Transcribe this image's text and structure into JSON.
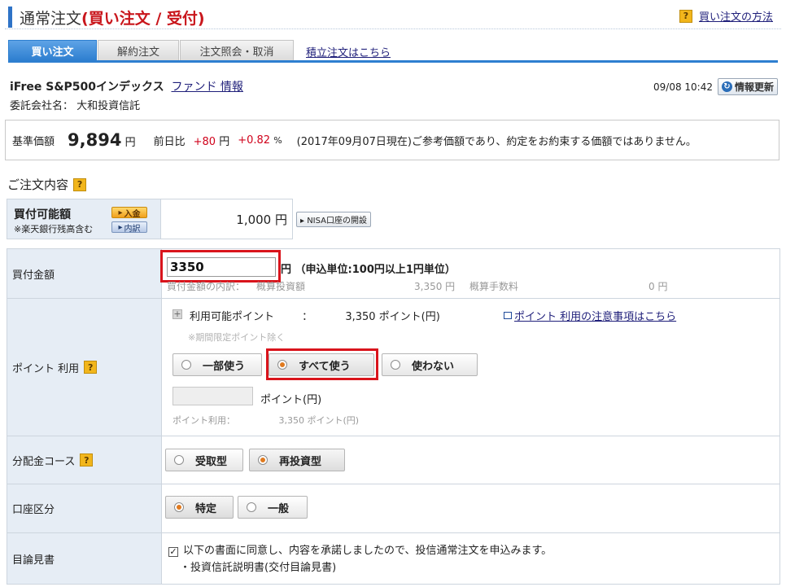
{
  "header": {
    "title_prefix": "通常注文",
    "title_mode": "(買い注文 / 受付)",
    "help_icon": "question-icon",
    "help_link": "買い注文の方法"
  },
  "tabs": [
    {
      "label": "買い注文",
      "active": true
    },
    {
      "label": "解約注文",
      "active": false
    },
    {
      "label": "注文照会・取消",
      "active": false
    }
  ],
  "tabs_link": "積立注文はこちら",
  "fund": {
    "name": "iFree S&P500インデックス",
    "info_link": "ファンド 情報",
    "company": "委託会社名： 大和投資信託",
    "datetime": "09/08 10:42",
    "refresh_label": "情報更新",
    "refresh_icon": "refresh-icon"
  },
  "price": {
    "label": "基準価額",
    "value": "9,894",
    "unit": "円",
    "change_label": "前日比",
    "change_value": "+80",
    "change_unit": "円",
    "change_pct": "+0.82",
    "pct_unit": "%",
    "note": "(2017年09月07日現在)ご参考価額であり、約定をお約束する価額ではありません。",
    "accent_color": "#d0021b"
  },
  "order": {
    "section_title": "ご注文内容",
    "available": {
      "label": "買付可能額",
      "sub": "※楽天銀行残高含む",
      "deposit_btn": "入金",
      "detail_btn": "内訳",
      "value": "1,000 円",
      "nisa_btn": "NISA口座の開設"
    },
    "amount": {
      "label": "買付金額",
      "value": "3350",
      "unit_note": "円 （申込単位:100円以上1円単位）",
      "breakdown_label": "買付金額の内訳：",
      "invest_label": "概算投資額",
      "invest_value": "3,350 円",
      "fee_label": "概算手数料",
      "fee_value": "0 円"
    },
    "points": {
      "label": "ポイント 利用",
      "available_label": "利用可能ポイント",
      "colon": "：",
      "available_value": "3,350 ポイント(円)",
      "note_link": "ポイント 利用の注意事項はこちら",
      "exclude_note": "※期間限定ポイント除く",
      "options": [
        "一部使う",
        "すべて使う",
        "使わない"
      ],
      "selected": "すべて使う",
      "input_unit": "ポイント(円)",
      "usage_label": "ポイント利用：",
      "usage_value": "3,350 ポイント(円)"
    },
    "distribution": {
      "label": "分配金コース",
      "options": [
        "受取型",
        "再投資型"
      ],
      "selected": "再投資型"
    },
    "account": {
      "label": "口座区分",
      "options": [
        "特定",
        "一般"
      ],
      "selected": "特定"
    },
    "prospectus": {
      "label": "目論見書",
      "checked": true,
      "agree_text": "以下の書面に同意し、内容を承諾しましたので、投信通常注文を申込みます。",
      "doc": "・投資信託説明書(交付目論見書)"
    }
  },
  "highlight_color": "#d9141c"
}
